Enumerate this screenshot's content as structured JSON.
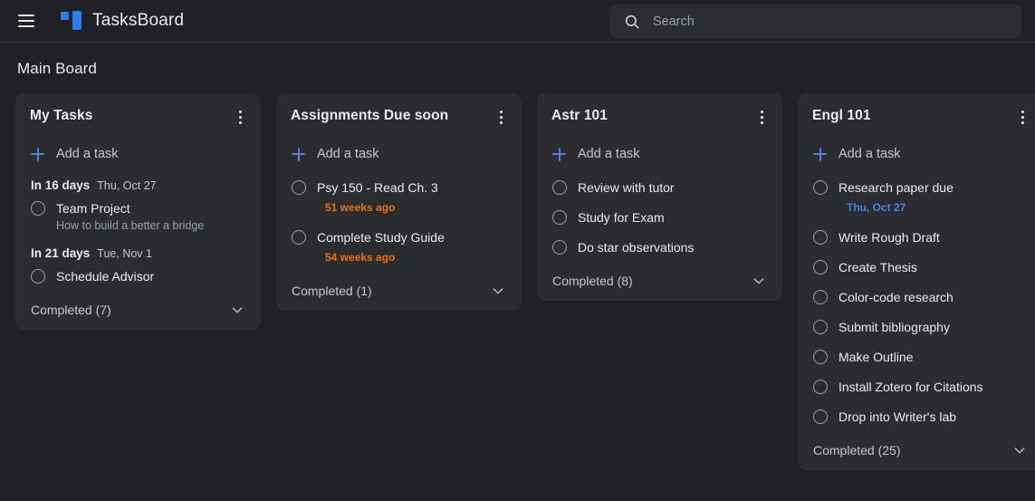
{
  "app": {
    "brand_title": "TasksBoard",
    "menu_icon": "hamburger-menu-icon",
    "logo_icon": "tasksboard-logo-icon"
  },
  "search": {
    "placeholder": "Search",
    "value": "",
    "icon": "search-icon"
  },
  "board": {
    "title": "Main Board",
    "menu_icon": "more-vertical-icon",
    "add_task_label": "Add a task",
    "add_icon": "plus-icon",
    "collapse_icon": "chevron-down-icon",
    "colors": {
      "background": "#202124",
      "card": "#2a2c30",
      "search_field": "#2b2d31",
      "accent_blue": "#4e82e8",
      "due_overdue": "#e8710a",
      "due_upcoming": "#4285f4",
      "text_primary": "#e8eaed",
      "text_secondary": "#9aa0a6"
    },
    "lists": [
      {
        "title": "My Tasks",
        "groups": [
          {
            "relative": "In 16 days",
            "absolute": "Thu, Oct 27",
            "tasks": [
              {
                "title": "Team Project",
                "note": "How to build a better a bridge"
              }
            ]
          },
          {
            "relative": "In 21 days",
            "absolute": "Tue, Nov 1",
            "tasks": [
              {
                "title": "Schedule Advisor"
              }
            ]
          }
        ],
        "completed_label": "Completed (7)"
      },
      {
        "title": "Assignments Due soon",
        "tasks": [
          {
            "title": "Psy 150 - Read Ch. 3",
            "due": "51 weeks ago",
            "due_state": "overdue"
          },
          {
            "title": "Complete Study Guide",
            "due": "54 weeks ago",
            "due_state": "overdue"
          }
        ],
        "completed_label": "Completed (1)"
      },
      {
        "title": "Astr 101",
        "tasks": [
          {
            "title": "Review with tutor"
          },
          {
            "title": "Study for Exam"
          },
          {
            "title": "Do star observations"
          }
        ],
        "completed_label": "Completed (8)"
      },
      {
        "title": "Engl 101",
        "tasks": [
          {
            "title": "Research paper due",
            "due": "Thu, Oct 27",
            "due_state": "upcoming"
          },
          {
            "title": "Write Rough Draft"
          },
          {
            "title": "Create Thesis"
          },
          {
            "title": "Color-code research"
          },
          {
            "title": "Submit bibliography"
          },
          {
            "title": "Make Outline"
          },
          {
            "title": "Install Zotero for Citations"
          },
          {
            "title": "Drop into Writer's lab"
          }
        ],
        "completed_label": "Completed (25)"
      }
    ]
  }
}
